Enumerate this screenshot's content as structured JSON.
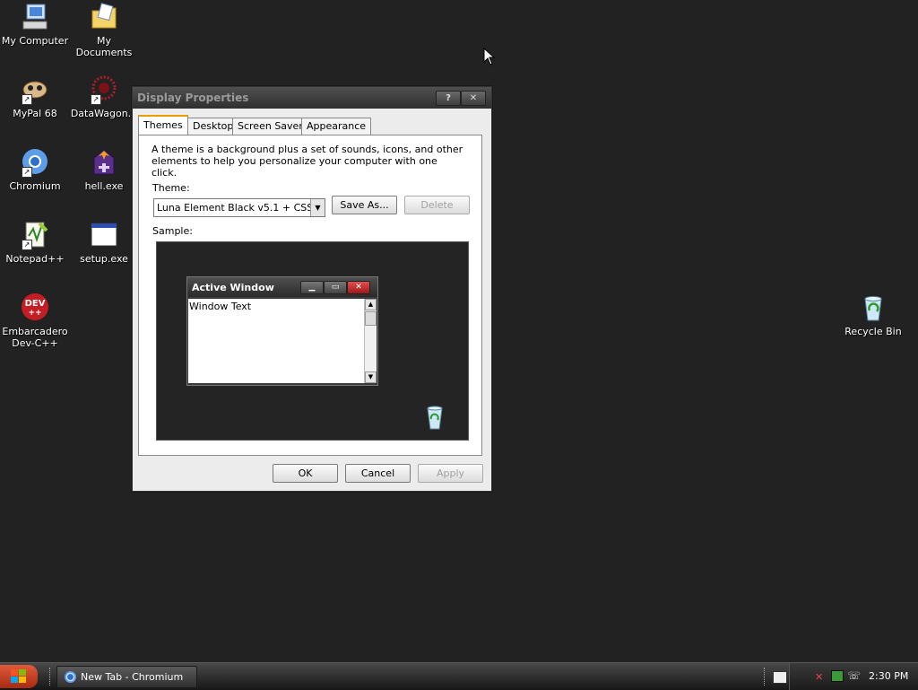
{
  "desktop": {
    "icons": [
      {
        "label": "My Computer",
        "icon": "my-computer-icon"
      },
      {
        "label": "My Documents",
        "icon": "my-documents-icon"
      },
      {
        "label": "MyPal 68",
        "icon": "mypal-icon"
      },
      {
        "label": "DataWagon...",
        "icon": "datawagon-icon"
      },
      {
        "label": "Chromium",
        "icon": "chromium-icon"
      },
      {
        "label": "hell.exe",
        "icon": "hell-exe-icon"
      },
      {
        "label": "Notepad++",
        "icon": "notepad-plus-plus-icon"
      },
      {
        "label": "setup.exe",
        "icon": "setup-exe-icon"
      },
      {
        "label": "Embarcadero Dev-C++",
        "icon": "devcpp-icon"
      },
      {
        "label": "Recycle Bin",
        "icon": "recycle-bin-icon"
      }
    ],
    "devcpp_badge": "DEV\n++"
  },
  "window": {
    "title": "Display Properties",
    "help_glyph": "?",
    "close_glyph": "✕",
    "tabs": [
      "Themes",
      "Desktop",
      "Screen Saver",
      "Appearance"
    ],
    "active_tab": "Themes",
    "description": "A theme is a background plus a set of sounds, icons, and other elements to help you personalize your computer with one click.",
    "theme_label": "Theme:",
    "theme_value": "Luna Element Black v5.1 + CSS",
    "save_as": "Save As...",
    "delete": "Delete",
    "sample_label": "Sample:",
    "sample": {
      "active_window_title": "Active Window",
      "window_text": "Window Text"
    },
    "ok": "OK",
    "cancel": "Cancel",
    "apply": "Apply"
  },
  "taskbar": {
    "task_label": "New Tab - Chromium",
    "clock": "2:30 PM"
  },
  "colors": {
    "desktop_bg": "#222222",
    "accent_tab": "#e8a000",
    "start_button": "#c2401f"
  }
}
